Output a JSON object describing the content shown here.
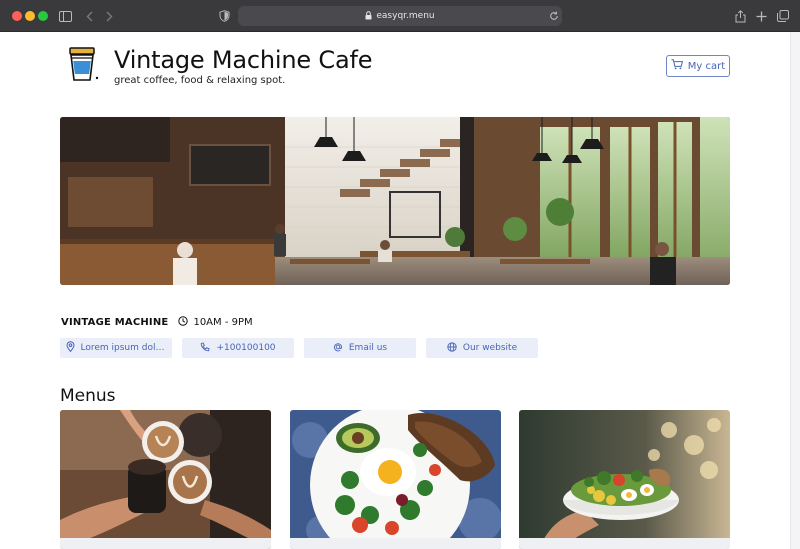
{
  "browser": {
    "url": "easyqr.menu",
    "icons": [
      "sidebar-icon",
      "back-icon",
      "forward-icon",
      "shield-icon",
      "lock-icon",
      "reload-icon",
      "share-icon",
      "new-tab-icon",
      "tabs-overview-icon"
    ]
  },
  "header": {
    "title": "Vintage Machine Cafe",
    "subtitle": "great coffee, food & relaxing spot.",
    "cart_label": "My cart",
    "cart_icon": "cart-icon",
    "logo_icon": "coffee-cup-logo-icon"
  },
  "info": {
    "name": "VINTAGE MACHINE",
    "hours": "10AM - 9PM",
    "hours_icon": "clock-icon"
  },
  "chips": [
    {
      "label": "Lorem ipsum dolor s...",
      "icon": "location-pin-icon"
    },
    {
      "label": "+100100100",
      "icon": "phone-icon"
    },
    {
      "label": "Email us",
      "icon": "at-sign-icon"
    },
    {
      "label": "Our website",
      "icon": "globe-icon"
    }
  ],
  "menus": {
    "heading": "Menus"
  },
  "colors": {
    "accent": "#4a64b6",
    "chip_bg": "#e9eef9",
    "chrome_bg": "#3a3a3c"
  }
}
